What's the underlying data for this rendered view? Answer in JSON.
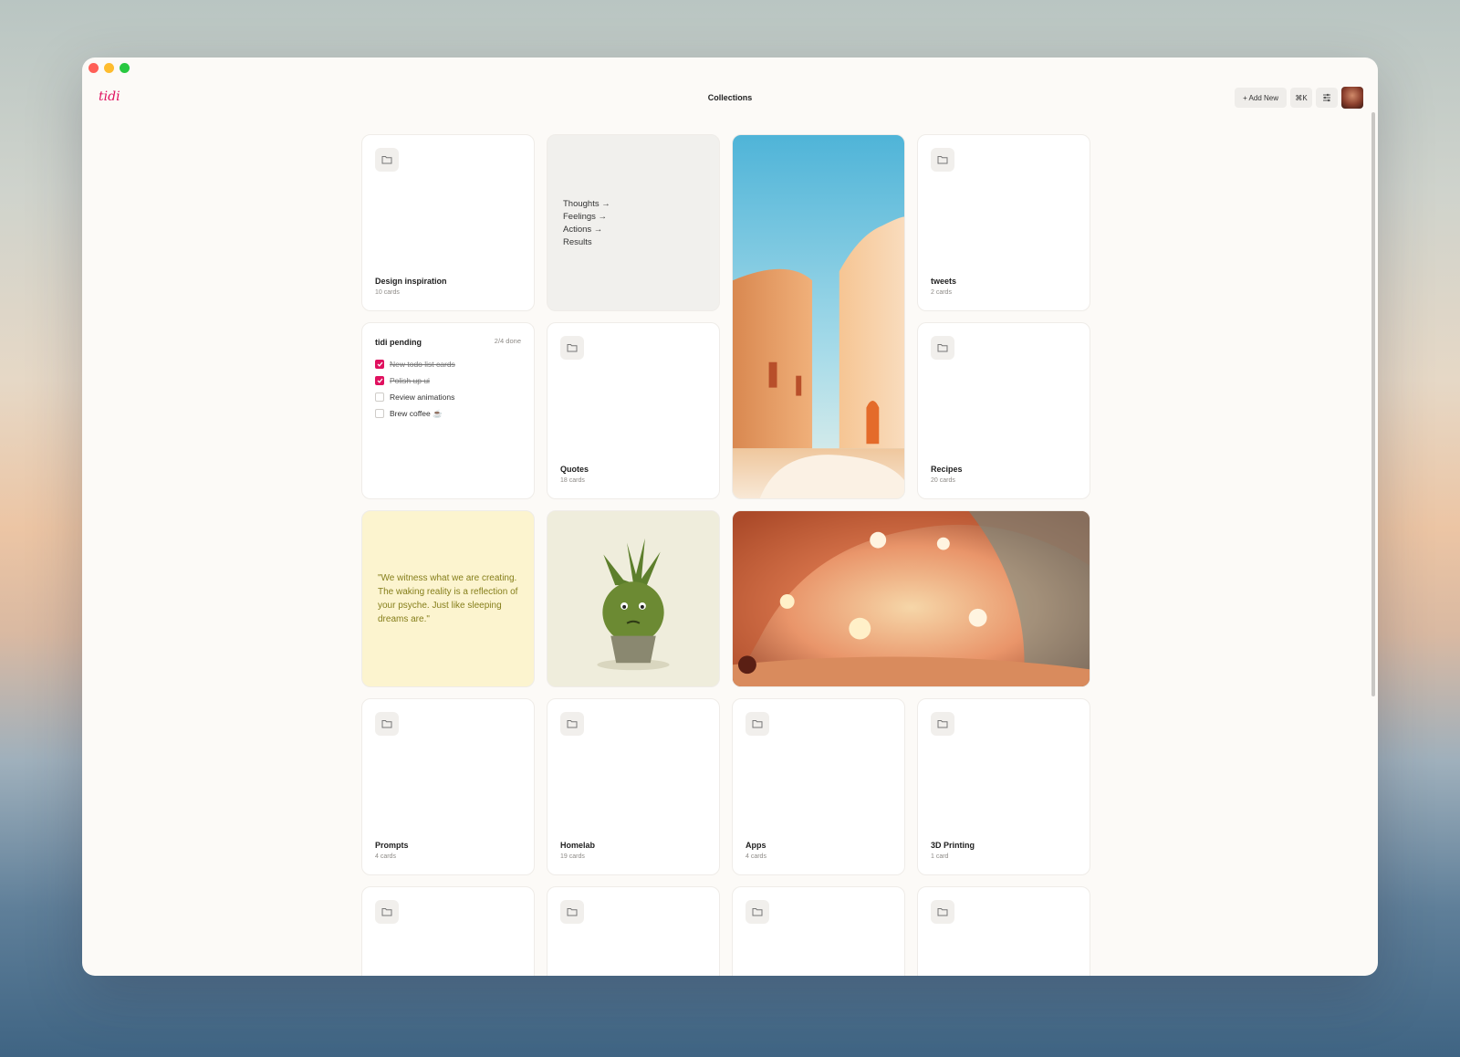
{
  "app": {
    "logo": "tidi",
    "title": "Collections"
  },
  "toolbar": {
    "add_new": "+ Add New",
    "shortcut": "⌘K",
    "filter_icon": "sliders-icon"
  },
  "cards": {
    "design": {
      "title": "Design inspiration",
      "count": "10 cards"
    },
    "note": {
      "lines": [
        "Thoughts →",
        "Feelings →",
        "Actions →",
        "Results"
      ]
    },
    "tweets": {
      "title": "tweets",
      "count": "2 cards"
    },
    "todo": {
      "title": "tidi pending",
      "status": "2/4 done",
      "items": [
        {
          "label": "New todo list cards",
          "done": true
        },
        {
          "label": "Polish up ui",
          "done": true
        },
        {
          "label": "Review animations",
          "done": false
        },
        {
          "label": "Brew coffee ☕",
          "done": false
        }
      ]
    },
    "quotes": {
      "title": "Quotes",
      "count": "18 cards"
    },
    "recipes": {
      "title": "Recipes",
      "count": "20 cards"
    },
    "quote": {
      "text": "\"We witness what we are creating. The waking reality is a reflection of your psyche. Just like sleeping dreams are.\""
    },
    "prompts": {
      "title": "Prompts",
      "count": "4 cards"
    },
    "homelab": {
      "title": "Homelab",
      "count": "19 cards"
    },
    "apps": {
      "title": "Apps",
      "count": "4 cards"
    },
    "printing": {
      "title": "3D Printing",
      "count": "1 card"
    }
  },
  "colors": {
    "accent": "#e0115f",
    "background": "#fcfaf7",
    "quote_bg": "#fcf4cf",
    "quote_text": "#857e1a"
  }
}
